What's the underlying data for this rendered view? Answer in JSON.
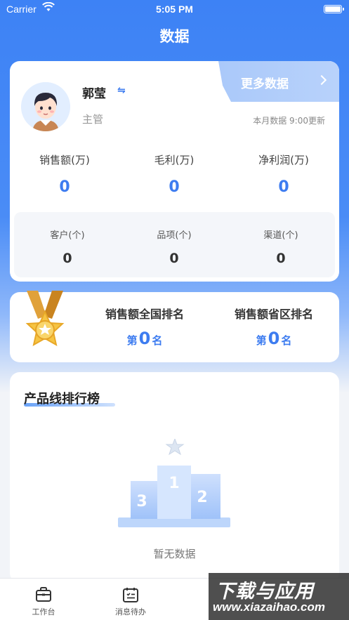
{
  "status_bar": {
    "carrier": "Carrier",
    "time": "5:05 PM"
  },
  "nav": {
    "title": "数据"
  },
  "profile": {
    "name": "郭莹",
    "switch_symbol": "⇋",
    "role": "主管",
    "more_label": "更多数据",
    "update_text": "本月数据 9:00更新"
  },
  "metrics": [
    {
      "label": "销售额(万)",
      "value": "0"
    },
    {
      "label": "毛利(万)",
      "value": "0"
    },
    {
      "label": "净利润(万)",
      "value": "0"
    }
  ],
  "sub_metrics": [
    {
      "label": "客户(个)",
      "value": "0"
    },
    {
      "label": "品项(个)",
      "value": "0"
    },
    {
      "label": "渠道(个)",
      "value": "0"
    }
  ],
  "ranking": [
    {
      "label": "销售额全国排名",
      "prefix": "第",
      "value": "0",
      "suffix": "名"
    },
    {
      "label": "销售额省区排名",
      "prefix": "第",
      "value": "0",
      "suffix": "名"
    }
  ],
  "product_line": {
    "title": "产品线排行榜",
    "empty_text": "暂无数据",
    "podium_numbers": [
      "1",
      "2",
      "3"
    ]
  },
  "tabs": [
    {
      "label": "工作台",
      "icon": "briefcase-icon"
    },
    {
      "label": "消息待办",
      "icon": "calendar-list-icon"
    }
  ],
  "watermark": {
    "line1": "下载与应用",
    "line2": "www.xiazaihao.com"
  },
  "colors": {
    "primary": "#3d7cf0",
    "header_gradient_top": "#3d82f5"
  }
}
